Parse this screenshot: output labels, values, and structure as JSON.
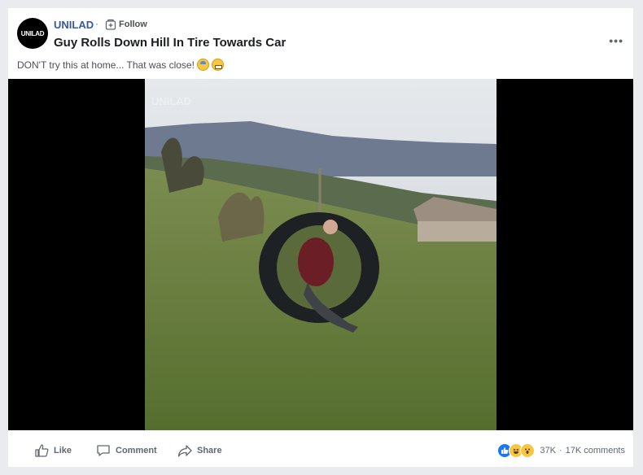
{
  "post": {
    "page_name": "UNILAD",
    "avatar_text": "UNILAD",
    "separator": "·",
    "follow_label": "Follow",
    "title": "Guy Rolls Down Hill In Tire Towards Car",
    "more_label": "•••",
    "caption": "DON'T try this at home... That was close!"
  },
  "video": {
    "watermark": "UNILAD"
  },
  "actions": {
    "like": "Like",
    "comment": "Comment",
    "share": "Share"
  },
  "stats": {
    "reactions_count": "37K",
    "separator": "·",
    "comments": "17K comments"
  },
  "colors": {
    "link_blue": "#385898",
    "background": "#e9ebee",
    "like_blue": "#1877f2"
  },
  "icons": [
    "follow-icon",
    "like-icon",
    "comment-icon",
    "share-icon",
    "like-reaction-icon",
    "haha-reaction-icon",
    "wow-reaction-icon",
    "fear-emoji-icon",
    "grimace-emoji-icon"
  ]
}
